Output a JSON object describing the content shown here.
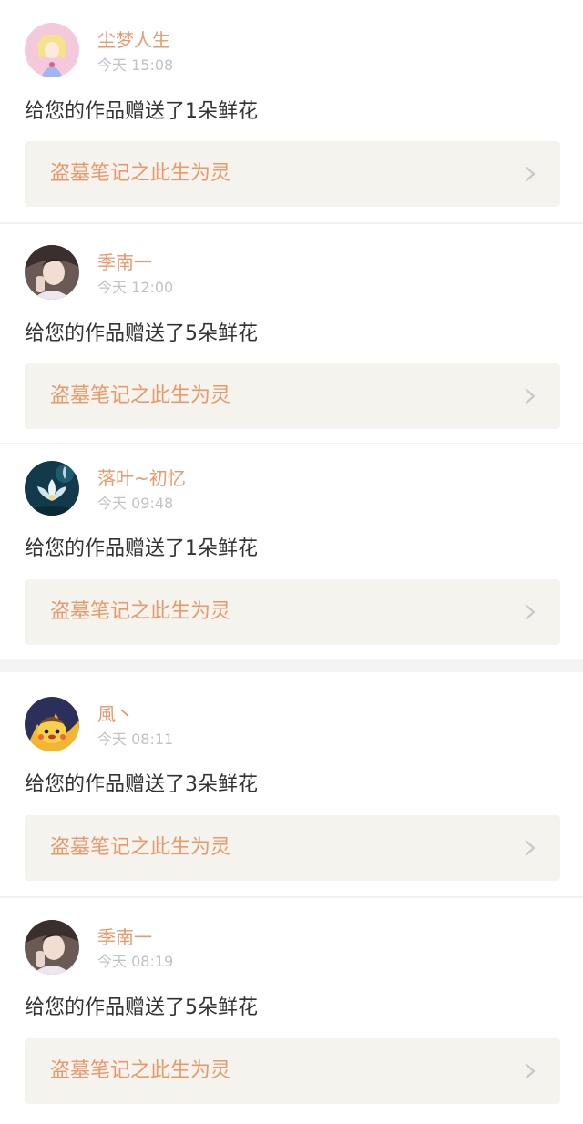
{
  "notifications": [
    {
      "username": "尘梦人生",
      "time": "今天 15:08",
      "message": "给您的作品赠送了1朵鲜花",
      "work_title": "盗墓笔记之此生为灵",
      "avatar_icon": "anime-character-avatar",
      "accent": "#e8996b"
    },
    {
      "username": "季南一",
      "time": "今天 12:00",
      "message": "给您的作品赠送了5朵鲜花",
      "work_title": "盗墓笔记之此生为灵",
      "avatar_icon": "portrait-photo-avatar"
    },
    {
      "username": "落叶~初忆",
      "time": "今天 09:48",
      "message": "给您的作品赠送了1朵鲜花",
      "work_title": "盗墓笔记之此生为灵",
      "avatar_icon": "lotus-flower-avatar"
    },
    {
      "username": "風丶",
      "time": "今天 08:11",
      "message": "给您的作品赠送了3朵鲜花",
      "work_title": "盗墓笔记之此生为灵",
      "avatar_icon": "cartoon-character-avatar"
    },
    {
      "username": "季南一",
      "time": "今天 08:19",
      "message": "给您的作品赠送了5朵鲜花",
      "work_title": "盗墓笔记之此生为灵",
      "avatar_icon": "portrait-photo-avatar"
    }
  ]
}
